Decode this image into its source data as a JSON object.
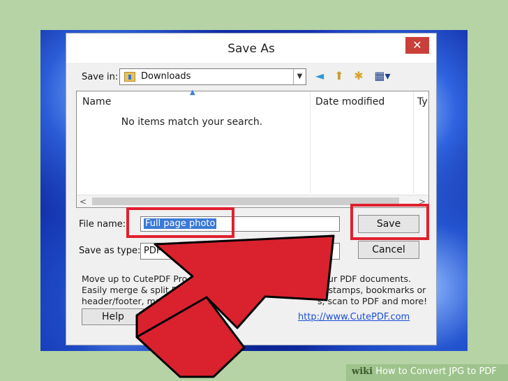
{
  "dialog": {
    "title": "Save As",
    "close_glyph": "✕"
  },
  "save_in": {
    "label": "Save in:",
    "value": "Downloads",
    "dropdown_glyph": "▼"
  },
  "toolbar": {
    "back_icon": "◄",
    "up_icon": "⬆",
    "new_folder_icon": "✱",
    "view_menu_icon": "▦▾"
  },
  "file_list": {
    "columns": [
      "Name",
      "Date modified",
      "Ty"
    ],
    "empty_message": "No items match your search.",
    "scroll_left": "<",
    "scroll_right": ">"
  },
  "file_name": {
    "label": "File name:",
    "value": "Full page photo"
  },
  "save_as_type": {
    "label": "Save as type:",
    "value": "PDF"
  },
  "buttons": {
    "save": "Save",
    "cancel": "Cancel",
    "help": "Help"
  },
  "promo": {
    "lines": [
      "Move up to CutePDF Pro",
      "Easily merge & split PDFs, a",
      "header/footer, make b"
    ],
    "lines_right": [
      "your PDF documents.",
      "e, stamps, bookmarks or",
      "s, scan to PDF and more!"
    ],
    "link": "http://www.CutePDF.com"
  },
  "footer": {
    "wiki": "wiki",
    "how_to": "How to Convert JPG to PDF"
  },
  "colors": {
    "highlight": "#e0202e",
    "arrow_fill": "#e0202e",
    "selection": "#3a79d6",
    "link": "#1a4fd6"
  }
}
